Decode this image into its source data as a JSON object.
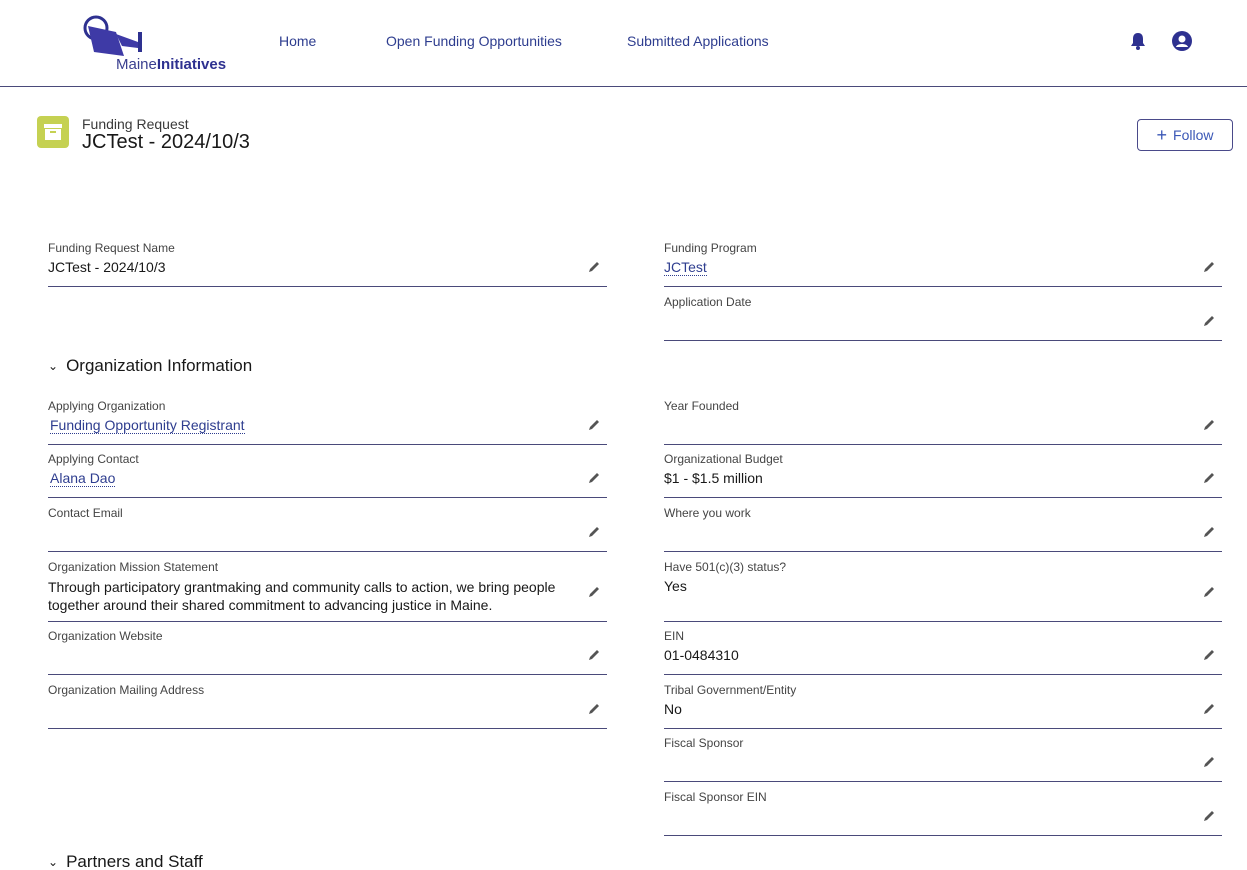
{
  "brand": {
    "logo_text_regular": "Maine",
    "logo_text_bold": "Initiatives"
  },
  "nav": {
    "home": "Home",
    "open_funding": "Open Funding Opportunities",
    "submitted": "Submitted Applications"
  },
  "record": {
    "type": "Funding Request",
    "title": "JCTest - 2024/10/3",
    "follow_label": "Follow"
  },
  "sections": {
    "org_info": "Organization Information",
    "partners": "Partners and Staff"
  },
  "fields": {
    "funding_request_name": {
      "label": "Funding Request Name",
      "value": "JCTest - 2024/10/3"
    },
    "funding_program": {
      "label": "Funding Program",
      "value": "JCTest"
    },
    "application_date": {
      "label": "Application Date",
      "value": ""
    },
    "applying_org": {
      "label": "Applying Organization",
      "value": "Funding Opportunity Registrant"
    },
    "year_founded": {
      "label": "Year Founded",
      "value": ""
    },
    "applying_contact": {
      "label": "Applying Contact",
      "value": "Alana Dao"
    },
    "org_budget": {
      "label": "Organizational Budget",
      "value": "$1 - $1.5 million"
    },
    "contact_email": {
      "label": "Contact Email",
      "value": ""
    },
    "where_you_work": {
      "label": "Where you work",
      "value": ""
    },
    "mission": {
      "label": "Organization Mission Statement",
      "value": "Through participatory grantmaking and community calls to action, we bring people together around their shared commitment to advancing justice in Maine."
    },
    "status_501c3": {
      "label": "Have 501(c)(3) status?",
      "value": "Yes"
    },
    "website": {
      "label": "Organization Website",
      "value": ""
    },
    "ein": {
      "label": "EIN",
      "value": "01-0484310"
    },
    "mailing_address": {
      "label": "Organization Mailing Address",
      "value": ""
    },
    "tribal": {
      "label": "Tribal Government/Entity",
      "value": "No"
    },
    "fiscal_sponsor": {
      "label": "Fiscal Sponsor",
      "value": ""
    },
    "fiscal_sponsor_ein": {
      "label": "Fiscal Sponsor EIN",
      "value": ""
    }
  },
  "colors": {
    "accent": "#2e3190",
    "record_icon": "#c5d152",
    "link": "#2e3d8f",
    "divider": "#4a4a7a"
  },
  "icons": {
    "logo": "watering-can-icon",
    "notifications": "bell-icon",
    "profile": "user-avatar-icon",
    "record": "archive-box-icon",
    "edit": "pencil-icon",
    "section_toggle": "chevron-down-icon"
  }
}
